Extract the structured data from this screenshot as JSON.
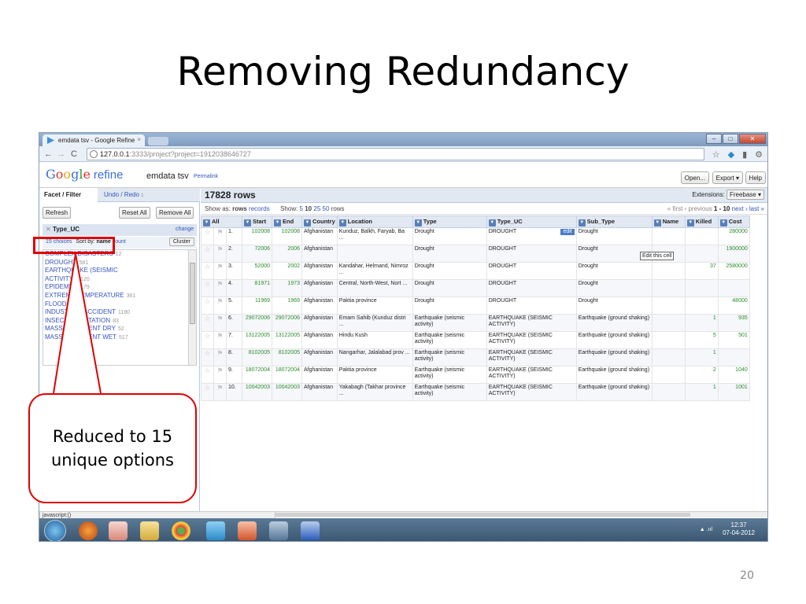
{
  "slide": {
    "title": "Removing Redundancy",
    "number": "20"
  },
  "browser": {
    "tab_title": "emdata tsv - Google Refine",
    "url_host": "127.0.0.1",
    "url_rest": ":3333/project?project=1912038646727"
  },
  "app": {
    "project_name": "emdata tsv",
    "permalink": "Permalink",
    "open_label": "Open...",
    "export_label": "Export ▾",
    "help_label": "Help"
  },
  "left": {
    "tab_facet": "Facet / Filter",
    "tab_undo": "Undo / Redo",
    "undo_count": "1",
    "refresh": "Refresh",
    "reset_all": "Reset All",
    "remove_all": "Remove All",
    "facet_title": "Type_UC",
    "facet_change": "change",
    "choices": "15 choices",
    "sort_by": "Sort by:",
    "sort_name": "name",
    "sort_count": "count",
    "cluster": "Cluster",
    "items": [
      {
        "name": "COMPLEX DISASTERS",
        "count": "12"
      },
      {
        "name": "DROUGHT",
        "count": "581"
      },
      {
        "name": "EARTHQUAKE (SEISMIC",
        "count": ""
      },
      {
        "name": "ACTIVITY)",
        "count": "1120"
      },
      {
        "name": "EPIDEMIC",
        "count": "1179"
      },
      {
        "name": "EXTREME TEMPERATURE",
        "count": "361"
      },
      {
        "name": "FLOOD",
        "count": "3512"
      },
      {
        "name": "INDUSTRIAL ACCIDENT",
        "count": "1190"
      },
      {
        "name": "INSECT INFESTATION",
        "count": "83"
      },
      {
        "name": "MASS MOVEMENT DRY",
        "count": "52"
      },
      {
        "name": "MASS MOVEMENT WET",
        "count": "517"
      }
    ]
  },
  "data": {
    "rows_label": "17828 rows",
    "extensions": "Extensions:",
    "freebase": "Freebase ▾",
    "show_as": "Show as:",
    "rows": "rows",
    "records": "records",
    "show": "Show:",
    "page_sizes": [
      "5",
      "10",
      "25",
      "50"
    ],
    "rows_word": "rows",
    "pager_first": "« first",
    "pager_prev": "‹ previous",
    "pager_range": "1 - 10",
    "pager_next": "next ›",
    "pager_last": "last »",
    "edit_label": "edit",
    "tooltip": "Edit this cell",
    "columns": [
      "All",
      "Start",
      "End",
      "Country",
      "Location",
      "Type",
      "Type_UC",
      "Sub_Type",
      "Name",
      "Killed",
      "Cost"
    ],
    "rows_data": [
      [
        "1.",
        "102008",
        "102008",
        "Afghanistan",
        "Kunduz, Balkh, Faryab, Ba ...",
        "Drought",
        "DROUGHT",
        "Drought",
        "",
        "",
        "280000"
      ],
      [
        "2.",
        "72006",
        "2006",
        "Afghanistan",
        "",
        "Drought",
        "DROUGHT",
        "Drought",
        "",
        "",
        "1900000"
      ],
      [
        "3.",
        "52000",
        "2002",
        "Afghanistan",
        "Kandahar, Helmand, Nimroz ...",
        "Drought",
        "DROUGHT",
        "Drought",
        "",
        "37",
        "2580000"
      ],
      [
        "4.",
        "81971",
        "1973",
        "Afghanistan",
        "Central, North-West, Nort ...",
        "Drought",
        "DROUGHT",
        "Drought",
        "",
        "",
        ""
      ],
      [
        "5.",
        "11969",
        "1969",
        "Afghanistan",
        "Paktia province",
        "Drought",
        "DROUGHT",
        "Drought",
        "",
        "",
        "48000"
      ],
      [
        "6.",
        "29072006",
        "29072006",
        "Afghanistan",
        "Emam Sahib (Kunduz distri ...",
        "Earthquake (seismic activity)",
        "EARTHQUAKE (SEISMIC ACTIVITY)",
        "Earthquake (ground shaking)",
        "",
        "1",
        "935"
      ],
      [
        "7.",
        "13122005",
        "13122005",
        "Afghanistan",
        "Hindu Kush",
        "Earthquake (seismic activity)",
        "EARTHQUAKE (SEISMIC ACTIVITY)",
        "Earthquake (ground shaking)",
        "",
        "5",
        "501"
      ],
      [
        "8.",
        "8102005",
        "8102005",
        "Afghanistan",
        "Nangarhar, Jalalabad prov ...",
        "Earthquake (seismic activity)",
        "EARTHQUAKE (SEISMIC ACTIVITY)",
        "Earthquake (ground shaking)",
        "",
        "1",
        ""
      ],
      [
        "9.",
        "18072004",
        "18072004",
        "Afghanistan",
        "Paktia province",
        "Earthquake (seismic activity)",
        "EARTHQUAKE (SEISMIC ACTIVITY)",
        "Earthquake (ground shaking)",
        "",
        "2",
        "1040"
      ],
      [
        "10.",
        "10042003",
        "10042003",
        "Afghanistan",
        "Yakabagh (Takhar province ...",
        "Earthquake (seismic activity)",
        "EARTHQUAKE (SEISMIC ACTIVITY)",
        "Earthquake (ground shaking)",
        "",
        "1",
        "1001"
      ]
    ]
  },
  "status_bar": "javascript:()",
  "taskbar": {
    "time": "12:37",
    "date": "07-04-2012"
  },
  "annotation": {
    "callout": "Reduced to 15 unique options",
    "color": "#e00000"
  }
}
